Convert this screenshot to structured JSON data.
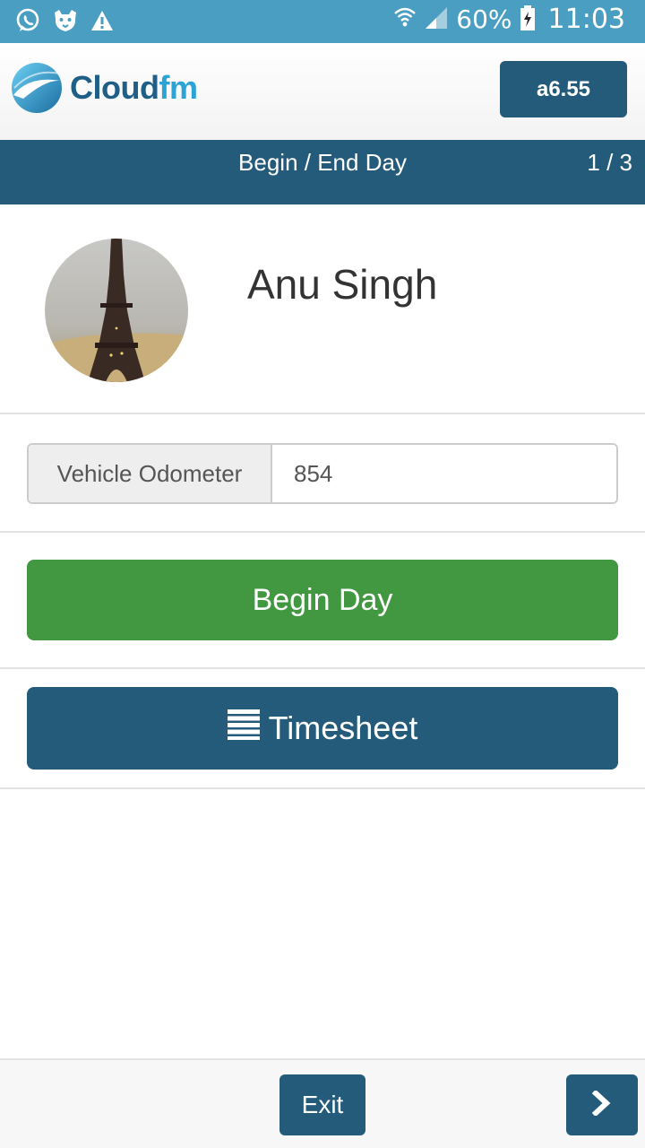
{
  "status_bar": {
    "battery_percent": "60%",
    "time": "11:03",
    "left_icons": [
      "whatsapp-icon",
      "tiger-app-icon",
      "warning-icon"
    ],
    "right_icons": [
      "wifi-icon",
      "signal-icon",
      "battery-charging-icon"
    ]
  },
  "header": {
    "logo_part1": "Cloud",
    "logo_part2": "fm",
    "version_label": "a6.55"
  },
  "title_bar": {
    "title": "Begin / End Day",
    "page_indicator": "1 / 3"
  },
  "profile": {
    "name": "Anu Singh",
    "avatar_icon": "eiffel-tower-photo"
  },
  "odometer": {
    "label": "Vehicle Odometer",
    "value": "854"
  },
  "actions": {
    "begin_label": "Begin Day",
    "timesheet_label": "Timesheet",
    "timesheet_icon": "list-icon"
  },
  "footer": {
    "exit_label": "Exit",
    "next_icon": "chevron-right-icon"
  },
  "colors": {
    "status_bar": "#4a9ec2",
    "primary": "#245b7b",
    "success": "#419841",
    "logo_dark": "#1f5f87",
    "logo_light": "#2ba3d6"
  }
}
